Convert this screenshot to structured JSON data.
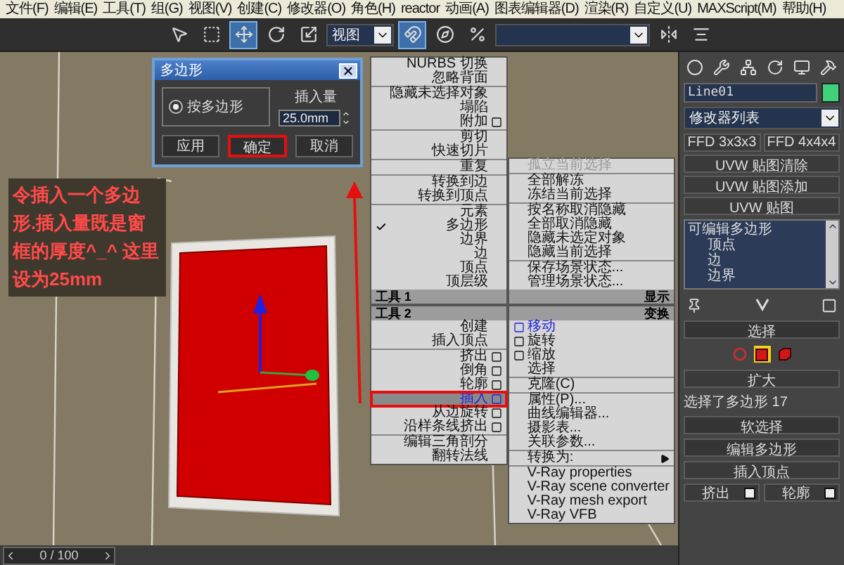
{
  "menu_bar": [
    "文件(F)",
    "编辑(E)",
    "工具(T)",
    "组(G)",
    "视图(V)",
    "创建(C)",
    "修改器(O)",
    "角色(H)",
    "reactor",
    "动画(A)",
    "图表编辑器(D)",
    "渲染(R)",
    "自定义(U)",
    "MAXScript(M)",
    "帮助(H)"
  ],
  "toolbar": {
    "tools": [
      {
        "kind": "select",
        "selected": false
      },
      {
        "kind": "region",
        "selected": false
      },
      {
        "kind": "move",
        "selected": true
      },
      {
        "kind": "rotate",
        "selected": false
      },
      {
        "kind": "scale",
        "selected": false
      }
    ],
    "view_dropdown": "视图",
    "snaps": [
      {
        "kind": "snap",
        "selected": true
      },
      {
        "kind": "angle_snap",
        "selected": false
      },
      {
        "kind": "percent_snap",
        "selected": false
      }
    ],
    "end_tools": [
      {
        "kind": "mirror"
      },
      {
        "kind": "align"
      }
    ]
  },
  "annotation": "令插入一个多边形.插入量既是窗框的厚度^_^ 这里设为25mm",
  "dialog": {
    "title": "多边形",
    "option": {
      "label": "按多边形",
      "selected": true
    },
    "amount_label": "插入量",
    "amount_value": "25.0mm",
    "buttons": [
      {
        "label": "应用",
        "highlighted": false
      },
      {
        "label": "确定",
        "highlighted": true
      },
      {
        "label": "取消",
        "highlighted": false
      }
    ]
  },
  "quad_menu": {
    "top_left": {
      "title": "工具 1",
      "groups": [
        [
          {
            "label": "NURBS 切换",
            "kind": "plain",
            "checked": false
          },
          {
            "label": "忽略背面",
            "kind": "plain",
            "checked": false
          }
        ],
        [
          {
            "label": "隐藏未选择对象",
            "kind": "plain",
            "checked": false
          },
          {
            "label": "塌陷",
            "kind": "plain",
            "checked": false
          },
          {
            "label": "附加",
            "kind": "option",
            "checked": false
          }
        ],
        [
          {
            "label": "剪切",
            "kind": "plain",
            "checked": false
          },
          {
            "label": "快速切片",
            "kind": "plain",
            "checked": false
          }
        ],
        [
          {
            "label": "重复",
            "kind": "plain",
            "checked": false
          }
        ],
        [
          {
            "label": "转换到边",
            "kind": "plain",
            "checked": false
          },
          {
            "label": "转换到顶点",
            "kind": "plain",
            "checked": false
          }
        ],
        [
          {
            "label": "元素",
            "kind": "plain",
            "checked": false
          },
          {
            "label": "多边形",
            "kind": "plain",
            "checked": true
          },
          {
            "label": "边界",
            "kind": "plain",
            "checked": false
          },
          {
            "label": "边",
            "kind": "plain",
            "checked": false
          },
          {
            "label": "顶点",
            "kind": "plain",
            "checked": false
          },
          {
            "label": "顶层级",
            "kind": "plain",
            "checked": false
          }
        ]
      ]
    },
    "top_right": {
      "title": "显示",
      "groups": [
        [
          {
            "label": "孤立当前选择",
            "kind": "plain",
            "disabled": true
          }
        ],
        [
          {
            "label": "全部解冻",
            "kind": "plain",
            "disabled": false
          },
          {
            "label": "冻结当前选择",
            "kind": "plain",
            "disabled": false
          }
        ],
        [
          {
            "label": "按名称取消隐藏",
            "kind": "plain",
            "disabled": false
          },
          {
            "label": "全部取消隐藏",
            "kind": "plain",
            "disabled": false
          },
          {
            "label": "隐藏未选定对象",
            "kind": "plain",
            "disabled": false
          },
          {
            "label": "隐藏当前选择",
            "kind": "plain",
            "disabled": false
          }
        ],
        [
          {
            "label": "保存场景状态...",
            "kind": "plain",
            "disabled": false
          },
          {
            "label": "管理场景状态...",
            "kind": "plain",
            "disabled": false
          }
        ]
      ]
    },
    "bottom_left": {
      "title": "工具 2",
      "groups": [
        [
          {
            "label": "创建",
            "kind": "plain",
            "selected": false
          },
          {
            "label": "插入顶点",
            "kind": "plain",
            "selected": false
          }
        ],
        [
          {
            "label": "挤出",
            "kind": "option",
            "selected": false
          },
          {
            "label": "倒角",
            "kind": "option",
            "selected": false
          },
          {
            "label": "轮廓",
            "kind": "option",
            "selected": false
          },
          {
            "label": "插入",
            "kind": "option",
            "selected": true
          },
          {
            "label": "从边旋转",
            "kind": "option",
            "selected": false
          },
          {
            "label": "沿样条线挤出",
            "kind": "option",
            "selected": false
          }
        ],
        [
          {
            "label": "编辑三角剖分",
            "kind": "plain",
            "selected": false
          },
          {
            "label": "翻转法线",
            "kind": "plain",
            "selected": false
          }
        ]
      ]
    },
    "bottom_right": {
      "title": "变换",
      "groups": [
        [
          {
            "label": "移动",
            "kind": "option",
            "last_used": true
          },
          {
            "label": "旋转",
            "kind": "option",
            "last_used": false
          },
          {
            "label": "缩放",
            "kind": "option",
            "last_used": false
          },
          {
            "label": "选择",
            "kind": "plain",
            "last_used": false
          }
        ],
        [
          {
            "label": "克隆(C)",
            "kind": "plain",
            "last_used": false
          }
        ],
        [
          {
            "label": "属性(P)...",
            "kind": "plain",
            "last_used": false
          },
          {
            "label": "曲线编辑器...",
            "kind": "plain",
            "last_used": false
          },
          {
            "label": "摄影表...",
            "kind": "plain",
            "last_used": false
          },
          {
            "label": "关联参数...",
            "kind": "plain",
            "last_used": false
          }
        ],
        [
          {
            "label": "转换为:",
            "kind": "submenu",
            "last_used": false
          }
        ],
        [
          {
            "label": "V-Ray properties",
            "kind": "plain",
            "last_used": false
          },
          {
            "label": "V-Ray scene converter",
            "kind": "plain",
            "last_used": false
          },
          {
            "label": "V-Ray mesh export",
            "kind": "plain",
            "last_used": false
          },
          {
            "label": "V-Ray VFB",
            "kind": "plain",
            "last_used": false
          }
        ]
      ]
    }
  },
  "command_panel": {
    "object_name": "Line01",
    "modifier_list": "修改器列表",
    "modifier_buttons": [
      {
        "label": "FFD 3x3x3",
        "kind": "half"
      },
      {
        "label": "FFD 4x4x4",
        "kind": "half"
      },
      {
        "label": "UVW 贴图清除",
        "kind": "full"
      },
      {
        "label": "UVW 贴图添加",
        "kind": "full"
      },
      {
        "label": "UVW 贴图",
        "kind": "full"
      }
    ],
    "stack": [
      {
        "label": "可编辑多边形",
        "children": [
          {
            "label": "顶点"
          },
          {
            "label": "边"
          },
          {
            "label": "边界"
          }
        ]
      }
    ],
    "selection_rollout": "选择",
    "selection_levels": [
      {
        "kind": "border",
        "selected": false
      },
      {
        "kind": "polygon",
        "selected": true
      },
      {
        "kind": "element",
        "selected": false
      }
    ],
    "grow_button": "扩大",
    "selection_info": "选择了多边形 17",
    "rollouts": [
      "软选择",
      "编辑多边形"
    ],
    "insert_vertex_button": "插入顶点",
    "tool_buttons": [
      "挤出",
      "轮廓"
    ]
  },
  "timeline": {
    "label": "0 / 100",
    "level": 0
  }
}
